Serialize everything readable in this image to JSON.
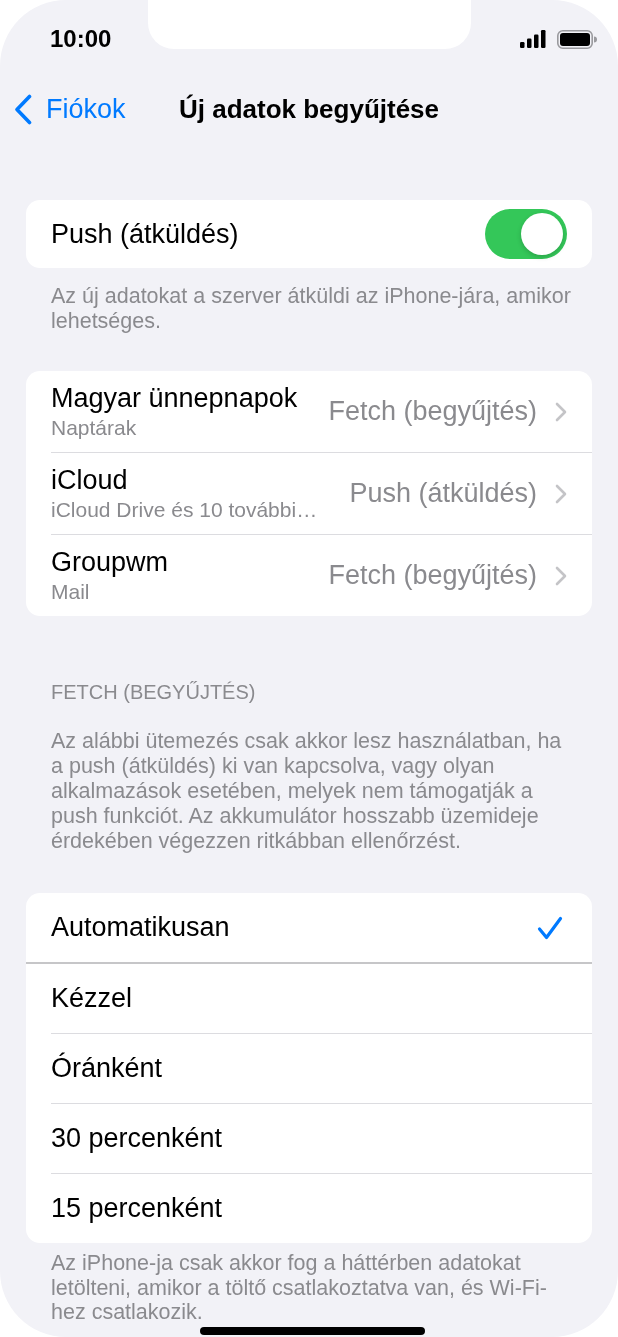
{
  "status_bar": {
    "time": "10:00"
  },
  "nav_bar": {
    "back_label": "Fiókok",
    "title": "Új adatok begyűjtése"
  },
  "push": {
    "label": "Push (átküldés)",
    "on": true,
    "footer": "Az új adatokat a szerver átküldi az iPhone-jára, amikor lehetséges."
  },
  "accounts": [
    {
      "name": "Magyar ünnepnapok",
      "detail": "Naptárak",
      "value": "Fetch (begyűjtés)"
    },
    {
      "name": "iCloud",
      "detail": "iCloud Drive és 10 további…",
      "value": "Push (átküldés)"
    },
    {
      "name": "Groupwm",
      "detail": "Mail",
      "value": "Fetch (begyűjtés)"
    }
  ],
  "fetch": {
    "header": "FETCH (BEGYŰJTÉS)",
    "description": "Az alábbi ütemezés csak akkor lesz használatban, ha a push (átküldés) ki van kapcsolva, vagy olyan alkalmazások esetében, melyek nem támogatják a push funkciót. Az akkumulátor hosszabb üzemideje érdekében végezzen ritkábban ellenőrzést.",
    "options": [
      {
        "label": "Automatikusan",
        "selected": true
      },
      {
        "label": "Kézzel",
        "selected": false
      },
      {
        "label": "Óránként",
        "selected": false
      },
      {
        "label": "30 percenként",
        "selected": false
      },
      {
        "label": "15 percenként",
        "selected": false
      }
    ],
    "footer": "Az iPhone-ja csak akkor fog a háttérben adatokat letölteni, amikor a töltő csatlakoztatva van, és Wi-Fi-hez csatlakozik."
  }
}
